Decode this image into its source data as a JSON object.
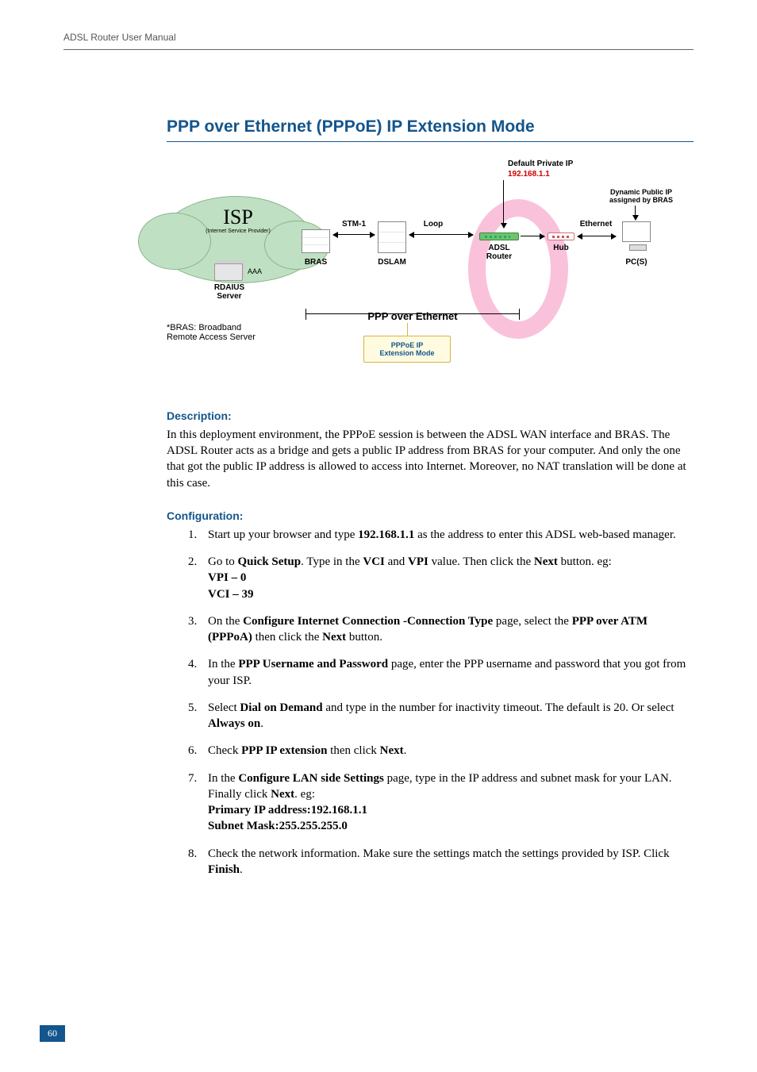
{
  "header": {
    "running": "ADSL Router User Manual"
  },
  "title": "PPP over Ethernet (PPPoE) IP Extension Mode",
  "diagram": {
    "isp": {
      "title": "ISP",
      "sub": "(Internet Service Provider)"
    },
    "aaa": "AAA",
    "radius": "RDAIUS\nServer",
    "bras_note": "*BRAS: Broadband\nRemote Access Server",
    "bras": "BRAS",
    "stm1": "STM-1",
    "dslam": "DSLAM",
    "loop": "Loop",
    "adsl_router": "ADSL\nRouter",
    "hub": "Hub",
    "ethernet": "Ethernet",
    "pcs": "PC(S)",
    "default_ip_t": "Default Private IP",
    "default_ip_v": "192.168.1.1",
    "dyn_ip": "Dynamic Public IP\nassigned by BRAS",
    "ppp_label": "PPP over Ethernet",
    "callout": "PPPoE IP\nExtension Mode"
  },
  "sections": {
    "desc_head": "Description:",
    "desc_body": "In this deployment environment, the PPPoE session is between the ADSL WAN interface and BRAS. The ADSL Router acts as a bridge and gets a public IP address from BRAS for your computer. And only the one that got the public IP address is allowed to access into Internet. Moreover, no NAT translation will be done at this case.",
    "conf_head": "Configuration:"
  },
  "steps": {
    "s1a": "Start up your browser and type ",
    "s1b": "192.168.1.1",
    "s1c": " as the address to enter this ADSL web-based manager.",
    "s2a": "Go to ",
    "s2b": "Quick Setup",
    "s2c": ". Type in the ",
    "s2d": "VCI",
    "s2e": " and ",
    "s2f": "VPI",
    "s2g": " value. Then click the ",
    "s2h": "Next",
    "s2i": " button. eg:",
    "s2j": "VPI – 0",
    "s2k": "VCI – 39",
    "s3a": "On the ",
    "s3b": "Configure Internet Connection -Connection Type",
    "s3c": " page, select the ",
    "s3d": "PPP over ATM (PPPoA)",
    "s3e": " then click the ",
    "s3f": "Next",
    "s3g": " button.",
    "s4a": "In the ",
    "s4b": "PPP Username and Password",
    "s4c": " page, enter the PPP username and password that you got from your ISP.",
    "s5a": "Select ",
    "s5b": "Dial on Demand",
    "s5c": " and type in the number for inactivity timeout. The default is 20. Or select ",
    "s5d": "Always on",
    "s5e": ".",
    "s6a": "Check ",
    "s6b": "PPP IP extension",
    "s6c": " then click ",
    "s6d": "Next",
    "s6e": ".",
    "s7a": "In the ",
    "s7b": "Configure LAN side Settings",
    "s7c": " page, type in the IP address and subnet mask for your LAN. Finally click ",
    "s7d": "Next",
    "s7e": ". eg:",
    "s7f": "Primary IP address:192.168.1.1",
    "s7g": "Subnet Mask:255.255.255.0",
    "s8a": "Check the network information. Make sure the settings match the settings provided by ISP. Click ",
    "s8b": "Finish",
    "s8c": "."
  },
  "pagenum": "60"
}
